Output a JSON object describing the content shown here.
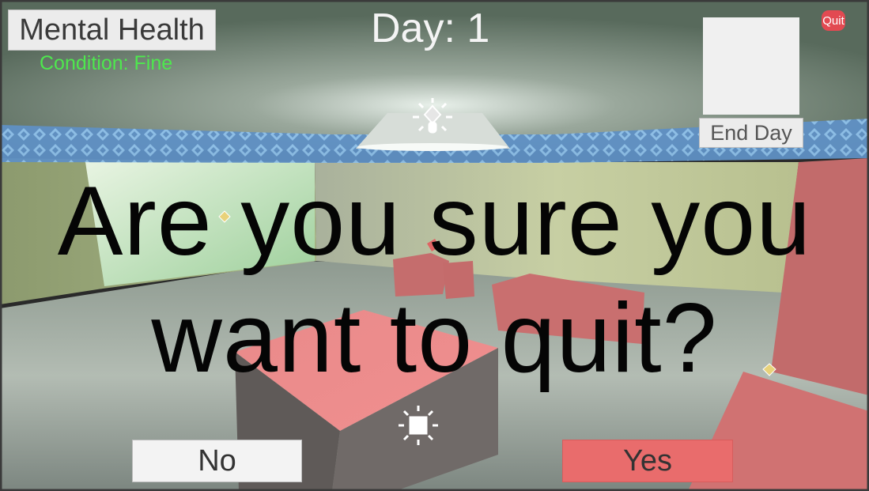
{
  "hud": {
    "mental_health_label": "Mental Health",
    "condition_text": "Condition: Fine",
    "day_text": "Day: 1",
    "end_day_label": "End Day",
    "quit_label": "Quit"
  },
  "dialog": {
    "question": "Are you sure you want to quit?",
    "no_label": "No",
    "yes_label": "Yes"
  },
  "colors": {
    "condition_green": "#4ee84e",
    "quit_red": "#e24a52",
    "yes_red": "#e96c6c",
    "wall_trim_blue": "#6fa8d8"
  },
  "icons": [
    "point-light-icon",
    "light-gizmo-icon",
    "marker-diamond-icon"
  ]
}
